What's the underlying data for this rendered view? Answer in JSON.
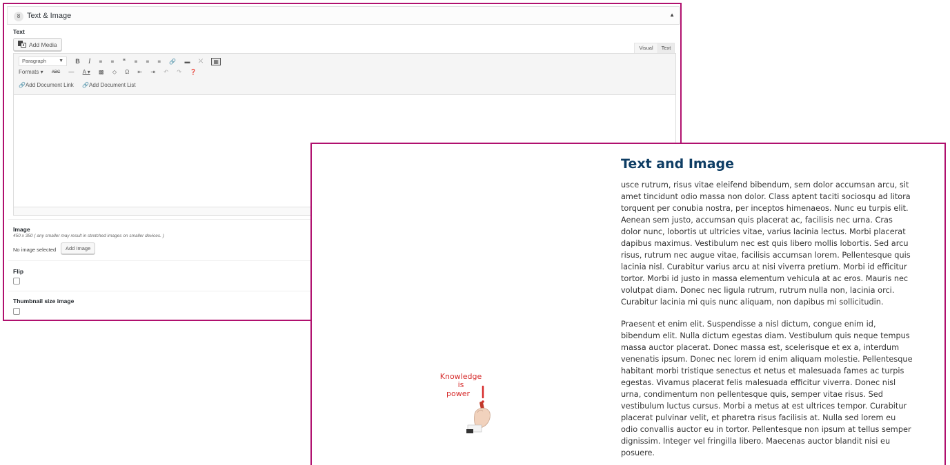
{
  "panel": {
    "number": "8",
    "title": "Text & Image",
    "toggle_icon": "triangle-up"
  },
  "text_field": {
    "label": "Text",
    "add_media_label": "Add Media",
    "tab_visual": "Visual",
    "tab_text": "Text",
    "paragraph_select": "Paragraph",
    "formats_label": "Formats",
    "add_document_link": "Add Document Link",
    "add_document_list": "Add Document List",
    "toolbar_row1_icons": [
      "bold",
      "italic",
      "bullet-list",
      "numbered-list",
      "blockquote",
      "align-left",
      "align-center",
      "align-right",
      "insert-link",
      "read-more",
      "fullscreen",
      "toolbar-toggle"
    ],
    "toolbar_row2_icons": [
      "strikethrough",
      "horizontal-line",
      "text-color",
      "paste-as-text",
      "clear-formatting",
      "special-character",
      "outdent",
      "indent",
      "undo",
      "redo",
      "help"
    ]
  },
  "image_field": {
    "label": "Image",
    "hint": "450 x 350 ( any smaller may result in stretched images on smaller devices. )",
    "status": "No image selected",
    "add_image_label": "Add Image"
  },
  "flip_field": {
    "label": "Flip",
    "checked": false
  },
  "thumbnail_field": {
    "label": "Thumbnail size image",
    "checked": false
  },
  "preview": {
    "title": "Text and Image",
    "image_text": [
      "Knowledge",
      "is",
      "power"
    ],
    "paragraphs": [
      "usce rutrum, risus vitae eleifend bibendum, sem dolor accumsan arcu, sit amet tincidunt odio massa non dolor. Class aptent taciti sociosqu ad litora torquent per conubia nostra, per inceptos himenaeos. Nunc eu turpis elit. Aenean sem justo, accumsan quis placerat ac, facilisis nec urna. Cras dolor nunc, lobortis ut ultricies vitae, varius lacinia lectus. Morbi placerat dapibus maximus. Vestibulum nec est quis libero mollis lobortis. Sed arcu risus, rutrum nec augue vitae, facilisis accumsan lorem. Pellentesque quis lacinia nisl. Curabitur varius arcu at nisi viverra pretium. Morbi id efficitur tortor. Morbi id justo in massa elementum vehicula at ac eros. Mauris nec volutpat diam. Donec nec ligula rutrum, rutrum nulla non, lacinia orci. Curabitur lacinia mi quis nunc aliquam, non dapibus mi sollicitudin.",
      "Praesent et enim elit. Suspendisse a nisl dictum, congue enim id, bibendum elit. Nulla dictum egestas diam. Vestibulum quis neque tempus massa auctor placerat. Donec massa est, scelerisque et ex a, interdum venenatis ipsum. Donec nec lorem id enim aliquam molestie. Pellentesque habitant morbi tristique senectus et netus et malesuada fames ac turpis egestas. Vivamus placerat felis malesuada efficitur viverra. Donec nisl urna, condimentum non pellentesque quis, semper vitae risus. Sed vestibulum luctus cursus. Morbi a metus at est ultrices tempor. Curabitur placerat pulvinar velit, et pharetra risus facilisis at. Nulla sed lorem eu odio convallis auctor eu in tortor. Pellentesque non ipsum at tellus semper dignissim. Integer vel fringilla libero. Maecenas auctor blandit nisi eu posuere."
    ]
  },
  "colors": {
    "frame_border": "#b0106e",
    "preview_title": "#0e3d64",
    "art_red": "#d62a2a"
  }
}
